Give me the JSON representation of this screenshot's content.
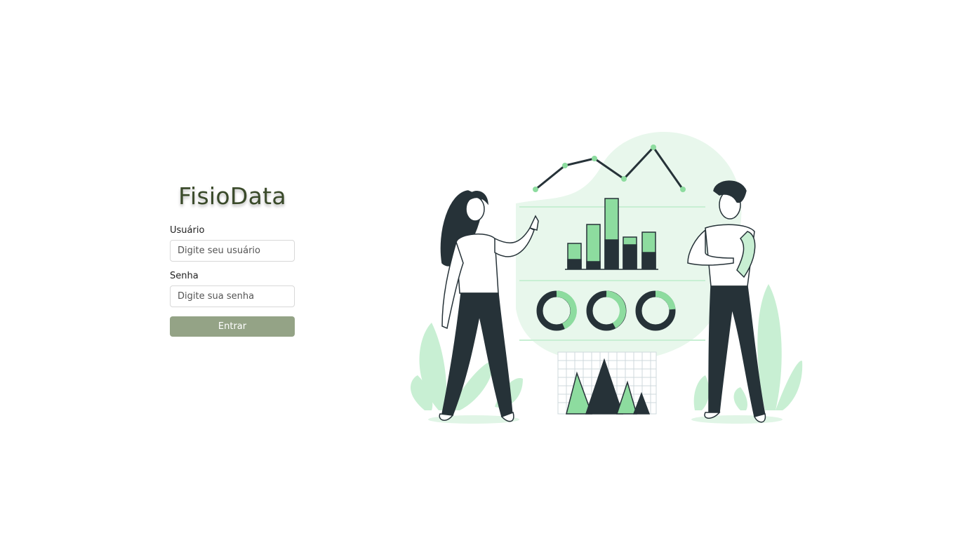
{
  "app": {
    "title": "FisioData"
  },
  "login": {
    "username_label": "Usuário",
    "username_placeholder": "Digite seu usuário",
    "password_label": "Senha",
    "password_placeholder": "Digite sua senha",
    "submit_label": "Entrar"
  },
  "colors": {
    "title": "#3a4a2a",
    "button": "#94a386",
    "illustration_accent": "#8ddc9f",
    "illustration_dark": "#263238",
    "illustration_light": "#e8f7ec"
  },
  "illustration": {
    "icon": "data-analysis-illustration"
  }
}
